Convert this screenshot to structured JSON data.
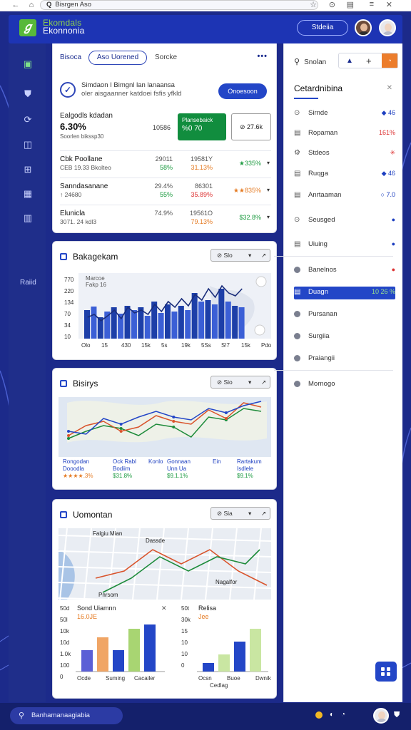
{
  "browser": {
    "url_text": "Bisrgen Aso",
    "search_glyph": "Q"
  },
  "app": {
    "brand_line1": "Ekomdals",
    "brand_line2": "Ekonnonia",
    "studio_button": "Stdeiia"
  },
  "rail": {
    "label": "Raiid"
  },
  "overview": {
    "tabs": [
      "Bisoca",
      "Aso Uorened",
      "Sorcke"
    ],
    "more": "•••",
    "info_line1": "Simdaon I Bimgnl lan lanaansa",
    "info_line2": "oler aisgaanner katdoei fsfis yfkld",
    "info_button": "Onoesoon",
    "metric_title": "Ealgodls kdadan",
    "metric_value": "6.30%",
    "metric_sub": "Soorlen bikssp30",
    "metric_mid": "10586",
    "green_label": "Plansebaick",
    "green_value": "%0 70",
    "outline_value": "⊘ 27.6k",
    "rows": [
      {
        "name": "Cbk Poollane",
        "sub": "CEB 19.33 Bkolteo",
        "c1": "29011",
        "c1b": "58%",
        "c2": "19581Y",
        "c2b": "31.13%",
        "c3": "★335%",
        "c1b_color": "green",
        "c2b_color": "orange",
        "c3_color": "green"
      },
      {
        "name": "Sanndasanane",
        "sub": "↑ 24680",
        "c1": "29.4%",
        "c1b": "55%",
        "c2": "86301",
        "c2b": "35.89%",
        "c3": "★★835%",
        "c1b_color": "green",
        "c2b_color": "red",
        "c3_color": "orange"
      },
      {
        "name": "Elunicla",
        "sub": "3071. 24 kdl3",
        "c1": "74.9%",
        "c1b": "",
        "c2": "19561O",
        "c2b": "79.13%",
        "c3": "$32.8%",
        "c1b_color": "green",
        "c2b_color": "orange",
        "c3_color": "green"
      }
    ],
    "row_dd": "▾"
  },
  "chart1": {
    "title": "Bakagekam",
    "seg_a": "⊘ Slo",
    "seg_b": "▾",
    "seg_c": "↗",
    "annotation": "Marcoe\nFakp 16",
    "y_ticks": [
      "770",
      "220",
      "134",
      "70",
      "34",
      "10"
    ],
    "x_ticks": [
      "Olo",
      "15",
      "430",
      "15k",
      "5s",
      "19k",
      "5Ss",
      "S!7",
      "15k",
      "Pdo"
    ]
  },
  "chart_data": [
    {
      "type": "bar",
      "title": "Bakagekam",
      "yticks": [
        "770",
        "220",
        "134",
        "70",
        "34",
        "10"
      ],
      "xticks": [
        "Olo",
        "15",
        "430",
        "15k",
        "5s",
        "19k",
        "5Ss",
        "S!7",
        "15k",
        "Pdo"
      ],
      "values": [
        40,
        45,
        30,
        38,
        44,
        35,
        46,
        40,
        44,
        32,
        52,
        36,
        48,
        38,
        46,
        40,
        64,
        52,
        54,
        48,
        70,
        52,
        46,
        44
      ],
      "line": [
        30,
        34,
        25,
        32,
        40,
        28,
        44,
        36,
        40,
        34,
        48,
        38,
        52,
        44,
        56,
        46,
        62,
        54,
        70,
        58,
        74,
        64,
        60,
        70
      ]
    },
    {
      "type": "line",
      "title": "Bisirys",
      "series": [
        {
          "values": [
            20,
            30,
            38,
            34,
            24,
            40,
            36,
            22,
            50,
            46,
            62,
            58
          ],
          "color": "#1d8b3a"
        },
        {
          "values": [
            24,
            38,
            44,
            30,
            36,
            52,
            44,
            40,
            60,
            48,
            70,
            64
          ],
          "color": "#d9532b"
        },
        {
          "values": [
            30,
            26,
            48,
            40,
            50,
            58,
            50,
            46,
            62,
            56,
            66,
            72
          ],
          "color": "#2346c7"
        }
      ]
    },
    {
      "type": "bar",
      "title": "Sond Uiamnn",
      "yticks": [
        "50d",
        "50l",
        "10k",
        "10d",
        "1.0k",
        "100",
        "0"
      ],
      "categories": [
        "Ocde",
        "Suming",
        "Cacailer"
      ],
      "values": [
        25,
        40,
        25,
        50,
        55
      ],
      "colors": [
        "#5b5fd6",
        "#f0a565",
        "#2346c7",
        "#a8d572",
        "#2346c7"
      ]
    },
    {
      "type": "bar",
      "title": "Relisa",
      "yticks": [
        "50t",
        "30k",
        "15",
        "10",
        "10",
        "0"
      ],
      "categories": [
        "Ocsn",
        "Buoe",
        "Dwnik"
      ],
      "values": [
        10,
        20,
        35,
        50
      ],
      "colors": [
        "#2346c7",
        "#c9e6a2",
        "#2346c7",
        "#c9e6a2"
      ]
    }
  ],
  "chart2": {
    "title": "Bisirys",
    "seg_a": "⊘ Sio",
    "seg_b": "▾",
    "seg_c": "↗",
    "labels": [
      {
        "l1": "Rongodan",
        "l2": "Dooodla",
        "l3": "★★★★.3%"
      },
      {
        "l1": "Ock Rabl",
        "l2": "Bodiim",
        "l3": "$31.8%"
      },
      {
        "l1": "Konlo",
        "l2": "",
        "l3": ""
      },
      {
        "l1": "Gonnaan",
        "l2": "Unn Ua",
        "l3": "$9.1.1%"
      },
      {
        "l1": "Ein",
        "l2": "",
        "l3": ""
      },
      {
        "l1": "Rartakum",
        "l2": "Isdlele",
        "l3": "$9.1%"
      }
    ]
  },
  "chart3": {
    "title": "Uomontan",
    "seg_a": "⊘ Sia",
    "seg_b": "▾",
    "seg_c": "↗",
    "map_labels": [
      "Falgiu Mian",
      "Dassde",
      "Nagalfor",
      "Pnrsom"
    ],
    "left_title": "Sond Uiamnn",
    "left_subtitle": "16.0JE",
    "left_close": "✕",
    "left_yticks": [
      "50d",
      "50l",
      "10k",
      "10d",
      "1.0k",
      "100",
      "0"
    ],
    "left_x": [
      "Ocde",
      "Suming",
      "Cacailer"
    ],
    "right_title": "Relisa",
    "right_subtitle": "Jee",
    "right_yticks": [
      "50t",
      "30k",
      "15",
      "10",
      "10",
      "0"
    ],
    "right_x": [
      "Ocsn",
      "Buoe",
      "Dwnik"
    ],
    "right_x2": "Cedlag"
  },
  "right_panel": {
    "search": "Snolan",
    "title": "Cetardnibina",
    "close": "✕",
    "items": [
      {
        "label": "Sirnde",
        "value": "◆ 46",
        "vcolor": "#1d3fc0"
      },
      {
        "label": "Ropaman",
        "value": "161%",
        "vcolor": "#d33"
      },
      {
        "label": "Stdeos",
        "value": "✳",
        "vcolor": "#d33"
      },
      {
        "label": "Ruqga",
        "value": "◆ 46",
        "vcolor": "#1d3fc0"
      },
      {
        "label": "Anrtaaman",
        "value": "○ 7.0",
        "vcolor": "#1d3fc0"
      },
      {
        "label": "Seusged",
        "value": "●",
        "vcolor": "#1d3fc0"
      },
      {
        "label": "Uiuing",
        "value": "●",
        "vcolor": "#1d3fc0"
      },
      {
        "label": "Banelnos",
        "value": "●",
        "vcolor": "#d33"
      },
      {
        "label": "Duagn",
        "value": "10 26 %",
        "vcolor": "#9be38d"
      },
      {
        "label": "Pursanan",
        "value": "",
        "vcolor": "#333"
      },
      {
        "label": "Surgiia",
        "value": "",
        "vcolor": "#333"
      },
      {
        "label": "Praiangii",
        "value": "",
        "vcolor": "#333"
      },
      {
        "label": "Mornogo",
        "value": "",
        "vcolor": "#333"
      }
    ]
  },
  "taskbar": {
    "search": "Banhamanaagiabia"
  }
}
